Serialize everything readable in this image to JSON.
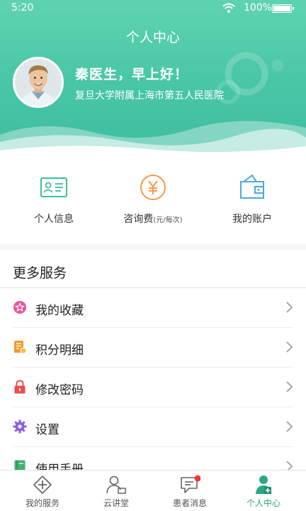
{
  "status_bar": {
    "time": "5:20",
    "battery": "100%"
  },
  "header": {
    "title": "个人中心",
    "greeting": "秦医生，早上好！",
    "hospital": "复旦大学附属上海市第五人民医院"
  },
  "quick_actions": [
    {
      "label": "个人信息",
      "icon": "id-card-icon"
    },
    {
      "label": "咨询费",
      "suffix": "(元/每次)",
      "icon": "yuan-coin-icon"
    },
    {
      "label": "我的账户",
      "icon": "wallet-icon"
    }
  ],
  "services": {
    "title": "更多服务",
    "items": [
      {
        "label": "我的收藏",
        "icon": "star-badge-icon",
        "color": "#e8569a"
      },
      {
        "label": "积分明细",
        "icon": "points-doc-icon",
        "color": "#f29a2e"
      },
      {
        "label": "修改密码",
        "icon": "lock-icon",
        "color": "#ec4d4d"
      },
      {
        "label": "设置",
        "icon": "gear-icon",
        "color": "#8a5fe0"
      },
      {
        "label": "使用手册",
        "icon": "book-icon",
        "color": "#3fb36e"
      }
    ]
  },
  "bottom_nav": {
    "items": [
      {
        "label": "我的服务",
        "icon": "plus-diamond-icon",
        "active": false
      },
      {
        "label": "云讲堂",
        "icon": "lecturer-icon",
        "active": false
      },
      {
        "label": "患者消息",
        "icon": "chat-icon",
        "active": false,
        "badge": true
      },
      {
        "label": "个人中心",
        "icon": "doctor-profile-icon",
        "active": true
      }
    ]
  },
  "colors": {
    "accent": "#48c6a6",
    "active_nav": "#27a985",
    "badge": "#f03a3a"
  }
}
